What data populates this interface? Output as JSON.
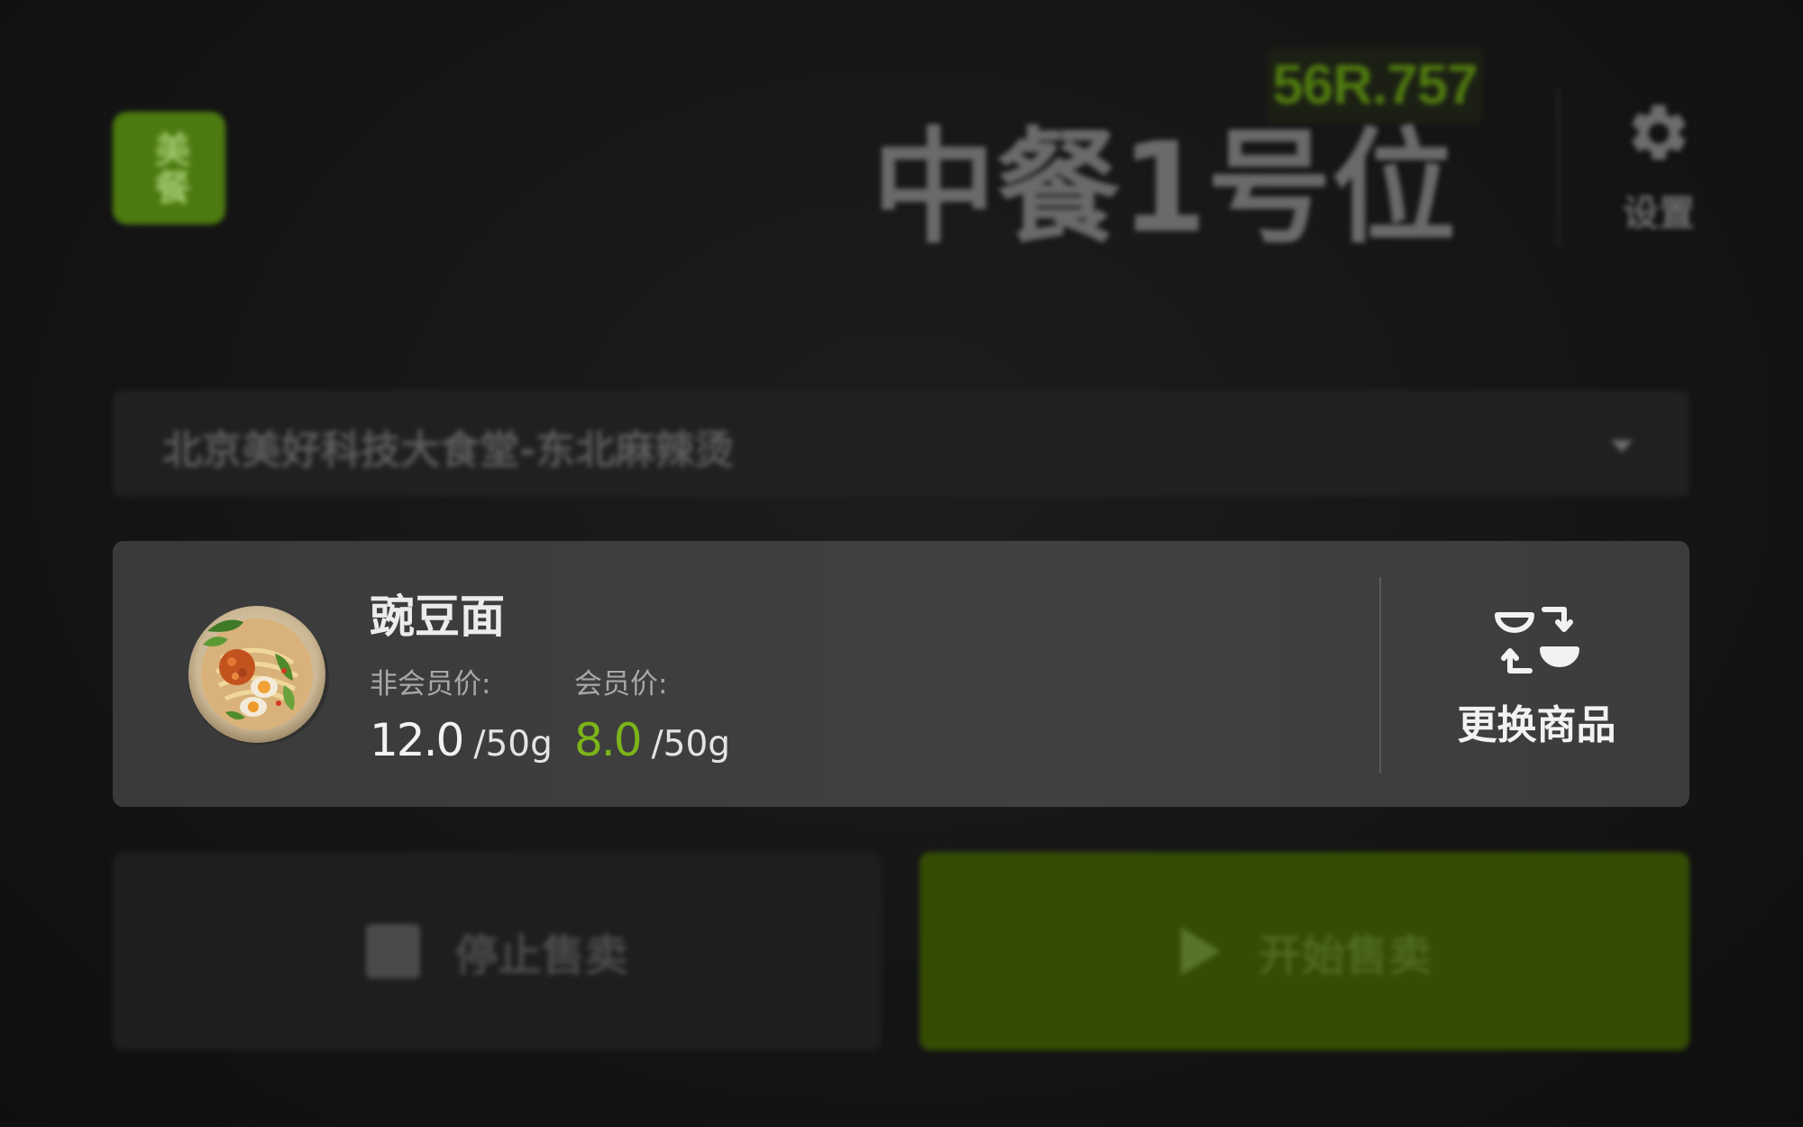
{
  "header": {
    "logo_text": "美餐",
    "device_id": "56R.757",
    "station_title": "中餐1号位",
    "settings_label": "设置"
  },
  "store_select": {
    "value": "北京美好科技大食堂-东北麻辣烫"
  },
  "product": {
    "name": "豌豆面",
    "non_member_label": "非会员价:",
    "non_member_price": "12.0",
    "non_member_unit": "/50g",
    "member_label": "会员价:",
    "member_price": "8.0",
    "member_unit": "/50g",
    "image_icon": "noodle-bowl-image"
  },
  "swap_button": {
    "label": "更换商品",
    "icon": "swap-bowls-icon"
  },
  "actions": {
    "stop_label": "停止售卖",
    "start_label": "开始售卖"
  },
  "colors": {
    "accent_green": "#7cb518",
    "start_button_bg": "#344c04",
    "card_bg": "#3e3e3e"
  }
}
